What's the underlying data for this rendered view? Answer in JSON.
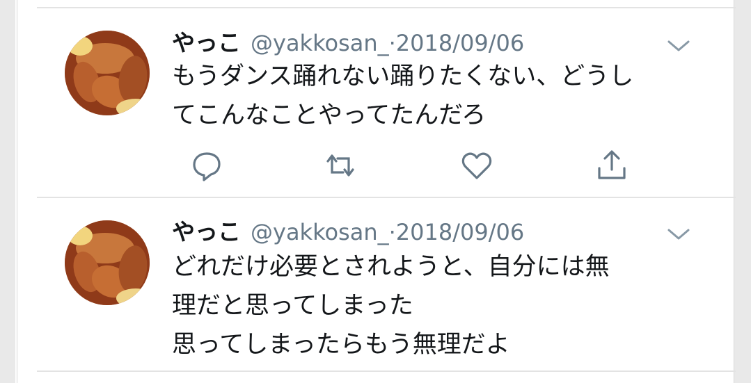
{
  "colors": {
    "text_primary": "#14171a",
    "text_secondary": "#657786",
    "divider": "#e3e3e3"
  },
  "tweets": [
    {
      "display_name": "やっこ",
      "handle": "@yakkosan_",
      "separator": "·",
      "date": "2018/09/06",
      "text": "もうダンス踊れない踊りたくない、どうし\nてこんなことやってたんだろ",
      "actions": [
        "reply-icon",
        "retweet-icon",
        "like-icon",
        "share-icon"
      ]
    },
    {
      "display_name": "やっこ",
      "handle": "@yakkosan_",
      "separator": "·",
      "date": "2018/09/06",
      "text": "どれだけ必要とされようと、自分には無\n理だと思ってしまった\n思ってしまったらもう無理だよ"
    }
  ]
}
